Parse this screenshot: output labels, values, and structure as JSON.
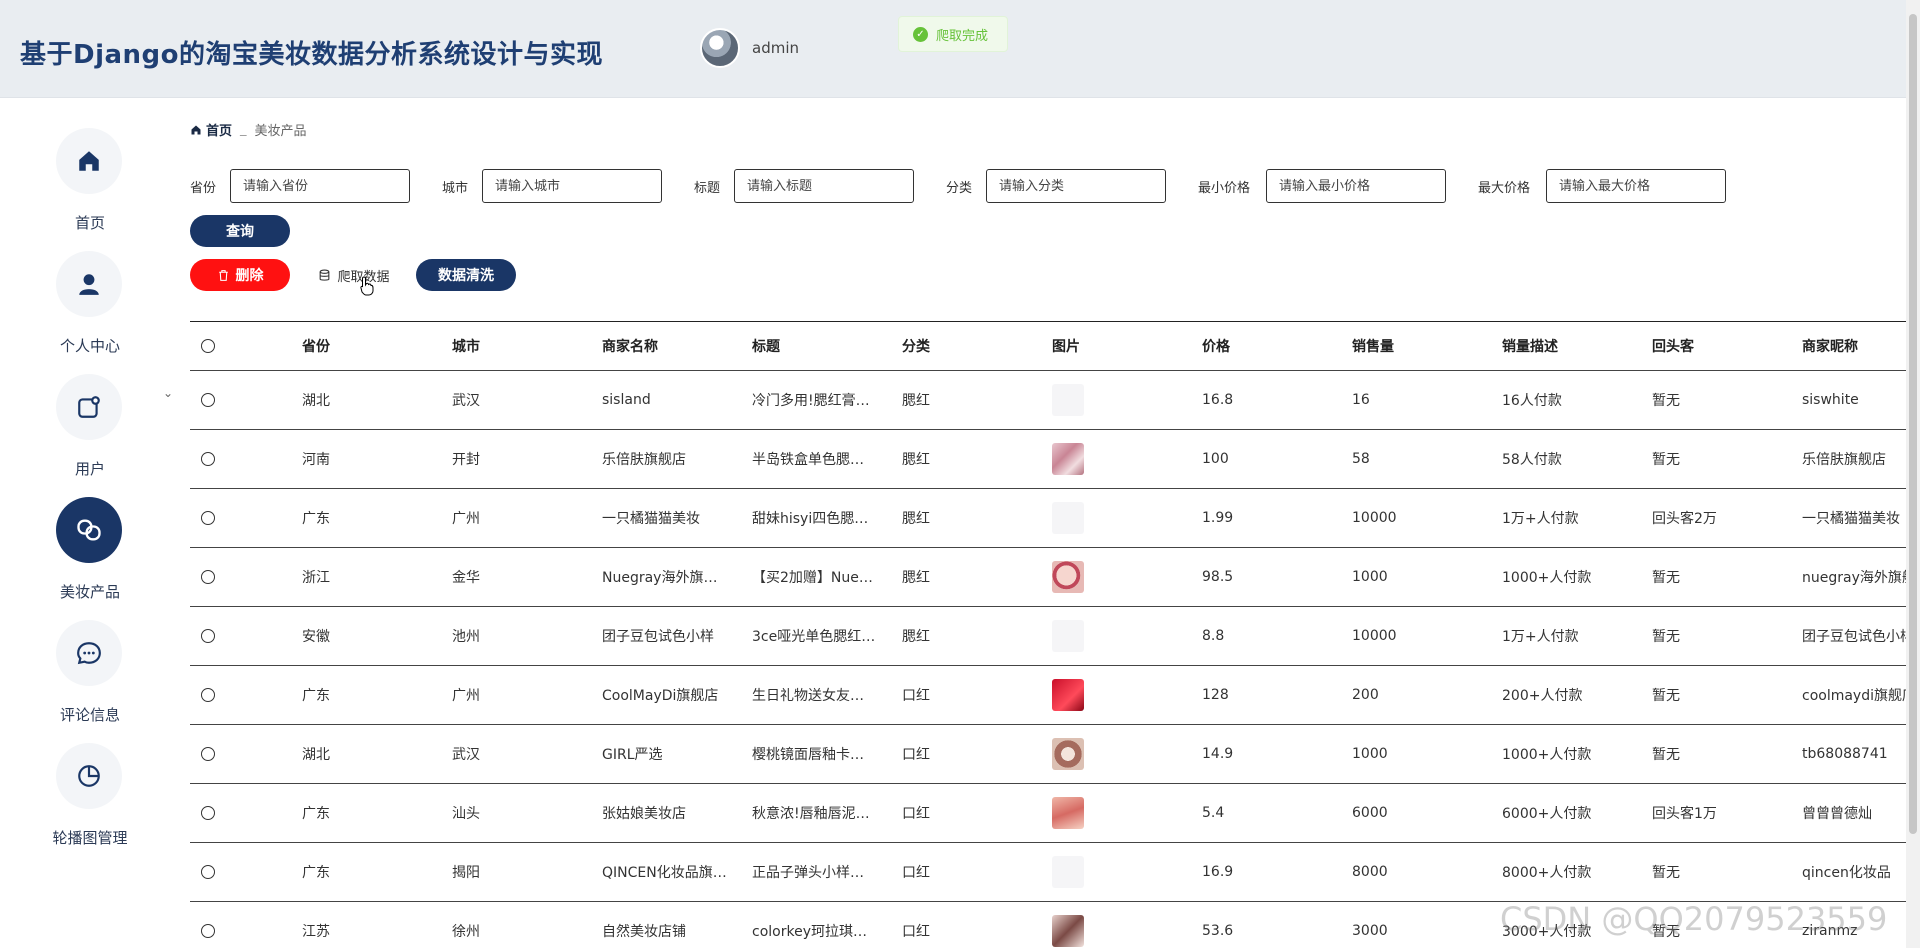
{
  "header": {
    "title": "基于Django的淘宝美妆数据分析系统设计与实现",
    "user_name": "admin"
  },
  "toast": {
    "text": "爬取完成",
    "color": "#67c23a"
  },
  "sidebar": {
    "items": [
      {
        "label": "首页",
        "icon": "home-icon"
      },
      {
        "label": "个人中心",
        "icon": "user-icon"
      },
      {
        "label": "用户",
        "icon": "user-square-icon"
      },
      {
        "label": "美妆产品",
        "icon": "link-icon",
        "active": true
      },
      {
        "label": "评论信息",
        "icon": "chat-icon"
      },
      {
        "label": "轮播图管理",
        "icon": "pie-chart-icon"
      }
    ]
  },
  "breadcrumb": {
    "home": "首页",
    "separator": "_",
    "current": "美妆产品"
  },
  "filters": [
    {
      "label": "省份",
      "placeholder": "请输入省份"
    },
    {
      "label": "城市",
      "placeholder": "请输入城市"
    },
    {
      "label": "标题",
      "placeholder": "请输入标题"
    },
    {
      "label": "分类",
      "placeholder": "请输入分类"
    },
    {
      "label": "最小价格",
      "placeholder": "请输入最小价格"
    },
    {
      "label": "最大价格",
      "placeholder": "请输入最大价格"
    }
  ],
  "buttons": {
    "query": "查询",
    "delete": "删除",
    "crawl": "爬取数据",
    "clean": "数据清洗"
  },
  "colors": {
    "primary": "#1a3666",
    "danger": "#ff1111",
    "title": "#1f3f73"
  },
  "table": {
    "columns": [
      "省份",
      "城市",
      "商家名称",
      "标题",
      "分类",
      "图片",
      "价格",
      "销售量",
      "销量描述",
      "回头客",
      "商家昵称"
    ],
    "rows": [
      {
        "province": "湖北",
        "city": "武汉",
        "shop": "sisland",
        "title": "冷门多用!腮红膏…",
        "category": "腮红",
        "image": "blank",
        "price": "16.8",
        "sales": "16",
        "desc": "16人付款",
        "repeat": "暂无",
        "nick": "siswhite"
      },
      {
        "province": "河南",
        "city": "开封",
        "shop": "乐倍肤旗舰店",
        "title": "半岛铁盒单色腮…",
        "category": "腮红",
        "image": "pink",
        "price": "100",
        "sales": "58",
        "desc": "58人付款",
        "repeat": "暂无",
        "nick": "乐倍肤旗舰店"
      },
      {
        "province": "广东",
        "city": "广州",
        "shop": "一只橘猫猫美妆",
        "title": "甜妹hisyi四色腮…",
        "category": "腮红",
        "image": "blank",
        "price": "1.99",
        "sales": "10000",
        "desc": "1万+人付款",
        "repeat": "回头客2万",
        "nick": "一只橘猫猫美妆"
      },
      {
        "province": "浙江",
        "city": "金华",
        "shop": "Nuegray海外旗…",
        "title": "【买2加赠】Nue…",
        "category": "腮红",
        "image": "face",
        "price": "98.5",
        "sales": "1000",
        "desc": "1000+人付款",
        "repeat": "暂无",
        "nick": "nuegray海外旗舰店"
      },
      {
        "province": "安徽",
        "city": "池州",
        "shop": "团子豆包试色小样",
        "title": "3ce哑光单色腮红…",
        "category": "腮红",
        "image": "blank",
        "price": "8.8",
        "sales": "10000",
        "desc": "1万+人付款",
        "repeat": "暂无",
        "nick": "团子豆包试色小样"
      },
      {
        "province": "广东",
        "city": "广州",
        "shop": "CoolMayDi旗舰店",
        "title": "生日礼物送女友…",
        "category": "口红",
        "image": "red",
        "price": "128",
        "sales": "200",
        "desc": "200+人付款",
        "repeat": "暂无",
        "nick": "coolmaydi旗舰店"
      },
      {
        "province": "湖北",
        "city": "武汉",
        "shop": "GIRL严选",
        "title": "樱桃镜面唇釉卡…",
        "category": "口红",
        "image": "tan",
        "price": "14.9",
        "sales": "1000",
        "desc": "1000+人付款",
        "repeat": "暂无",
        "nick": "tb68088741"
      },
      {
        "province": "广东",
        "city": "汕头",
        "shop": "张姑娘美妆店",
        "title": "秋意浓!唇釉唇泥…",
        "category": "口红",
        "image": "rose",
        "price": "5.4",
        "sales": "6000",
        "desc": "6000+人付款",
        "repeat": "回头客1万",
        "nick": "曾曾曾德灿"
      },
      {
        "province": "广东",
        "city": "揭阳",
        "shop": "QINCEN化妆品旗…",
        "title": "正品子弹头小样…",
        "category": "口红",
        "image": "blank",
        "price": "16.9",
        "sales": "8000",
        "desc": "8000+人付款",
        "repeat": "暂无",
        "nick": "qincen化妆品"
      },
      {
        "province": "江苏",
        "city": "徐州",
        "shop": "自然美妆店铺",
        "title": "colorkey珂拉琪…",
        "category": "口红",
        "image": "dark",
        "price": "53.6",
        "sales": "3000",
        "desc": "3000+人付款",
        "repeat": "暂无",
        "nick": "ziranmz"
      }
    ]
  },
  "watermark": "CSDN @QQ2079523559"
}
